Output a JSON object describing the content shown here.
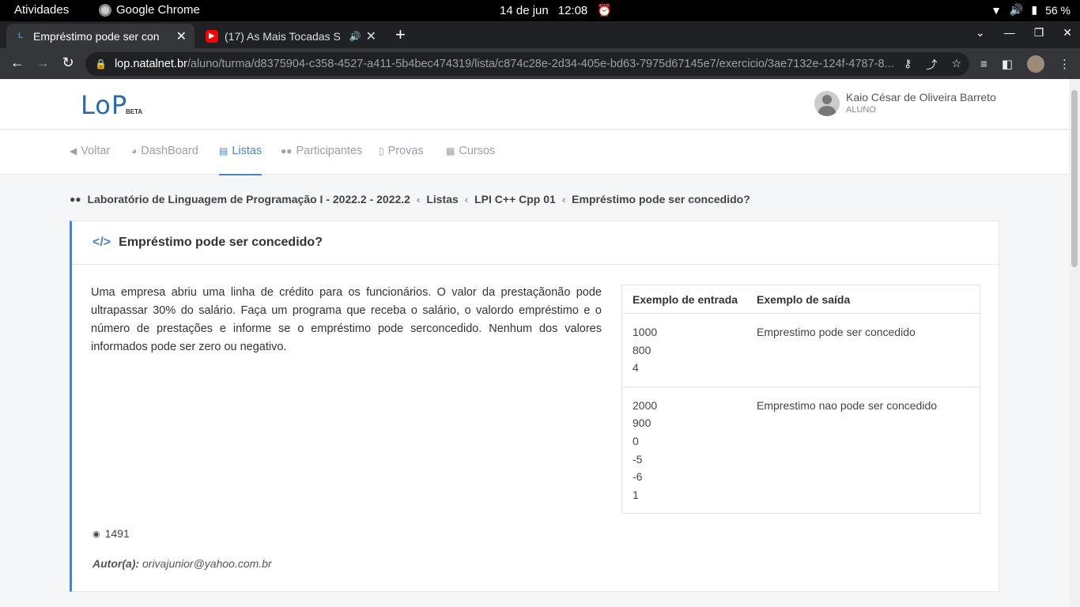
{
  "os": {
    "activities": "Atividades",
    "app_name": "Google Chrome",
    "date": "14 de jun",
    "time": "12:08",
    "battery": "56 %"
  },
  "browser": {
    "tabs": [
      {
        "label": "Empréstimo pode ser con",
        "favicon": "lop-favicon"
      },
      {
        "label": "(17) As Mais Tocadas S",
        "favicon": "youtube-favicon"
      }
    ],
    "url_host": "lop.natalnet.br",
    "url_path": "/aluno/turma/d8375904-c358-4527-a411-5b4bec474319/lista/c874c28e-2d34-405e-bd63-7975d67145e7/exercicio/3ae7132e-124f-4787-8..."
  },
  "site": {
    "logo": "LoP",
    "logo_badge": "BETA",
    "user_name": "Kaio César de Oliveira Barreto",
    "user_role": "ALUNO"
  },
  "nav": {
    "items": [
      {
        "label": "Voltar",
        "icon": "arrow-left-icon"
      },
      {
        "label": "DashBoard",
        "icon": "pie-chart-icon"
      },
      {
        "label": "Listas",
        "icon": "file-icon"
      },
      {
        "label": "Participantes",
        "icon": "users-icon"
      },
      {
        "label": "Provas",
        "icon": "document-icon"
      },
      {
        "label": "Cursos",
        "icon": "course-icon"
      }
    ],
    "active": "Listas"
  },
  "breadcrumb": {
    "items": [
      "Laboratório de Linguagem de Programação I - 2022.2 - 2022.2",
      "Listas",
      "LPI C++ Cpp 01",
      "Empréstimo pode ser concedido?"
    ]
  },
  "exercise": {
    "title": "Empréstimo pode ser concedido?",
    "description": "Uma empresa abriu uma linha de crédito para os funcionários. O valor da prestaçãonão pode ultrapassar 30% do salário. Faça um programa que receba o salário, o valordo empréstimo e o número de prestações e informe se o empréstimo pode serconcedido. Nenhum dos valores informados pode ser zero ou negativo.",
    "examples_header_in": "Exemplo de entrada",
    "examples_header_out": "Exemplo de saída",
    "examples": [
      {
        "input": [
          "1000",
          "800",
          "4"
        ],
        "output": "Emprestimo pode ser concedido"
      },
      {
        "input": [
          "2000",
          "900",
          "0",
          "-5",
          "-6",
          "1"
        ],
        "output": "Emprestimo nao pode ser concedido"
      }
    ],
    "views": "1491",
    "author_label": "Autor(a):",
    "author": "orivajunior@yahoo.com.br"
  }
}
